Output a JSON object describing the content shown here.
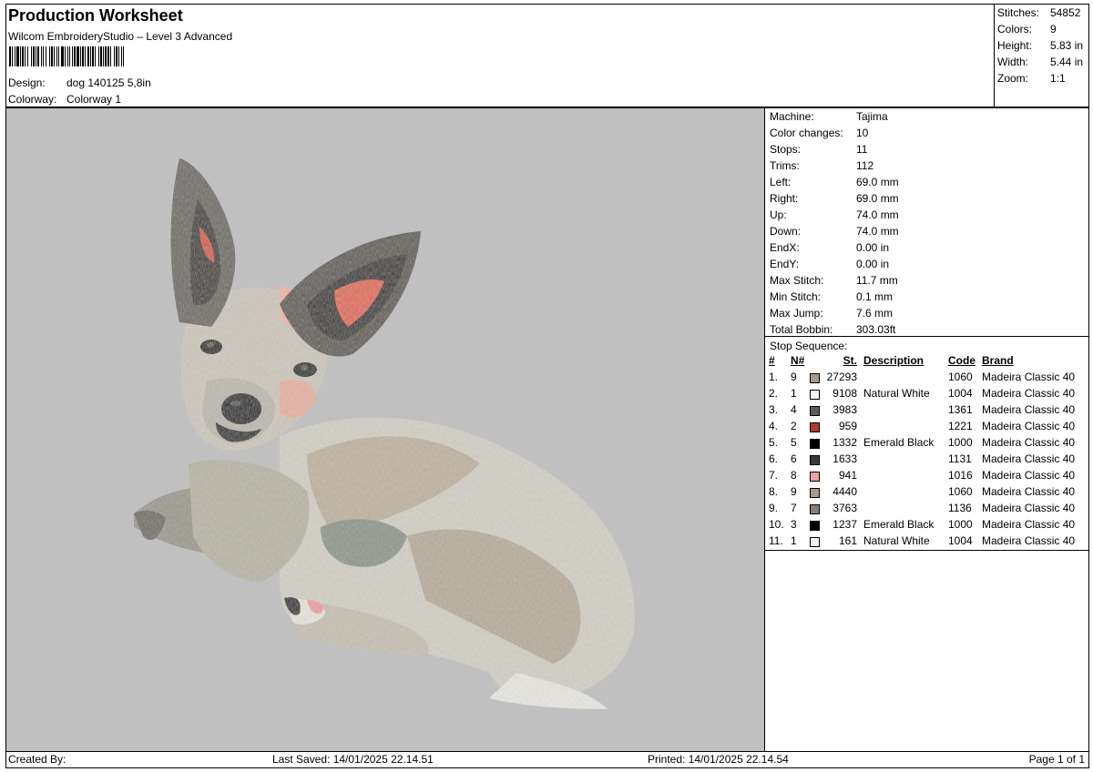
{
  "header": {
    "title": "Production Worksheet",
    "subtitle": "Wilcom EmbroideryStudio – Level 3 Advanced",
    "barcode_label": "barcode",
    "design_label": "Design:",
    "design_value": "dog 140125 5,8in",
    "colorway_label": "Colorway:",
    "colorway_value": "Colorway 1"
  },
  "stats": [
    {
      "label": "Stitches:",
      "value": "54852"
    },
    {
      "label": "Colors:",
      "value": "9"
    },
    {
      "label": "Height:",
      "value": "5.83 in"
    },
    {
      "label": "Width:",
      "value": "5.44 in"
    },
    {
      "label": "Zoom:",
      "value": "1:1"
    }
  ],
  "machine": [
    {
      "label": "Machine:",
      "value": "Tajima"
    },
    {
      "label": "Color changes:",
      "value": "10"
    },
    {
      "label": "Stops:",
      "value": "11"
    },
    {
      "label": "Trims:",
      "value": "112"
    },
    {
      "label": "Left:",
      "value": "69.0 mm"
    },
    {
      "label": "Right:",
      "value": "69.0 mm"
    },
    {
      "label": "Up:",
      "value": "74.0 mm"
    },
    {
      "label": "Down:",
      "value": "74.0 mm"
    },
    {
      "label": "EndX:",
      "value": "0.00 in"
    },
    {
      "label": "EndY:",
      "value": "0.00 in"
    },
    {
      "label": "Max Stitch:",
      "value": "11.7 mm"
    },
    {
      "label": "Min Stitch:",
      "value": "0.1 mm"
    },
    {
      "label": "Max Jump:",
      "value": "7.6 mm"
    },
    {
      "label": "Total Bobbin:",
      "value": "303.03ft"
    }
  ],
  "stop_sequence": {
    "title": "Stop Sequence:",
    "headers": {
      "num": "#",
      "n": "N#",
      "st": "St.",
      "desc": "Description",
      "code": "Code",
      "brand": "Brand"
    },
    "rows": [
      {
        "num": "1.",
        "n": "9",
        "color": "#a89a8c",
        "st": "27293",
        "desc": "",
        "code": "1060",
        "brand": "Madeira Classic 40"
      },
      {
        "num": "2.",
        "n": "1",
        "color": "#f4f4f0",
        "st": "9108",
        "desc": "Natural White",
        "code": "1004",
        "brand": "Madeira Classic 40"
      },
      {
        "num": "3.",
        "n": "4",
        "color": "#5a5a5a",
        "st": "3983",
        "desc": "",
        "code": "1361",
        "brand": "Madeira Classic 40"
      },
      {
        "num": "4.",
        "n": "2",
        "color": "#b03a2e",
        "st": "959",
        "desc": "",
        "code": "1221",
        "brand": "Madeira Classic 40"
      },
      {
        "num": "5.",
        "n": "5",
        "color": "#000000",
        "st": "1332",
        "desc": "Emerald Black",
        "code": "1000",
        "brand": "Madeira Classic 40"
      },
      {
        "num": "6.",
        "n": "6",
        "color": "#3a3a3a",
        "st": "1633",
        "desc": "",
        "code": "1131",
        "brand": "Madeira Classic 40"
      },
      {
        "num": "7.",
        "n": "8",
        "color": "#f0a0a0",
        "st": "941",
        "desc": "",
        "code": "1016",
        "brand": "Madeira Classic 40"
      },
      {
        "num": "8.",
        "n": "9",
        "color": "#a89a8c",
        "st": "4440",
        "desc": "",
        "code": "1060",
        "brand": "Madeira Classic 40"
      },
      {
        "num": "9.",
        "n": "7",
        "color": "#8a7e72",
        "st": "3763",
        "desc": "",
        "code": "1136",
        "brand": "Madeira Classic 40"
      },
      {
        "num": "10.",
        "n": "3",
        "color": "#000000",
        "st": "1237",
        "desc": "Emerald Black",
        "code": "1000",
        "brand": "Madeira Classic 40"
      },
      {
        "num": "11.",
        "n": "1",
        "color": "#f4f4f0",
        "st": "161",
        "desc": "Natural White",
        "code": "1004",
        "brand": "Madeira Classic 40"
      }
    ]
  },
  "footer": {
    "created_by": "Created By:",
    "last_saved": "Last Saved: 14/01/2025 22.14.51",
    "printed": "Printed: 14/01/2025 22.14.54",
    "page": "Page 1 of 1"
  },
  "preview": {
    "background": "#c0c0c0",
    "image_label": "dog-embroidery-design"
  }
}
